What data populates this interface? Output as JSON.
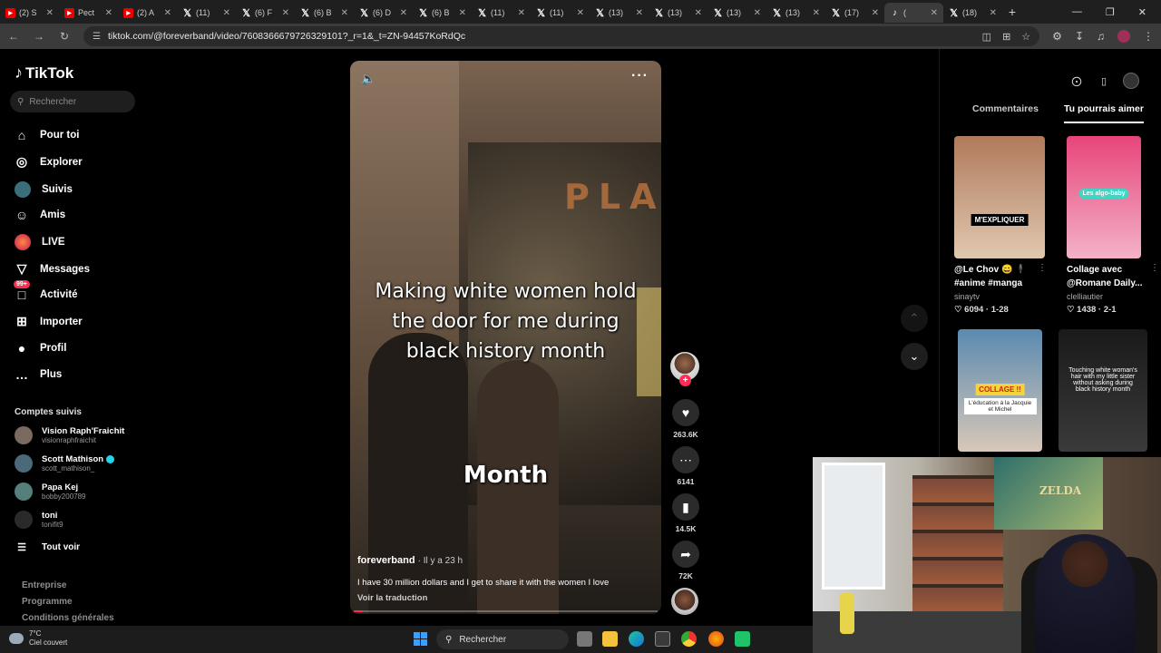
{
  "browser": {
    "tabs": [
      {
        "label": "(2) S",
        "fav": "youtube"
      },
      {
        "label": "Pect",
        "fav": "youtube"
      },
      {
        "label": "(2) A",
        "fav": "youtube"
      },
      {
        "label": "(11)",
        "fav": "x"
      },
      {
        "label": "(6) F",
        "fav": "x"
      },
      {
        "label": "(6) B",
        "fav": "x"
      },
      {
        "label": "(6) D",
        "fav": "x"
      },
      {
        "label": "(6) B",
        "fav": "x"
      },
      {
        "label": "(11)",
        "fav": "x"
      },
      {
        "label": "(11)",
        "fav": "x"
      },
      {
        "label": "(13)",
        "fav": "x"
      },
      {
        "label": "(13)",
        "fav": "x"
      },
      {
        "label": "(13)",
        "fav": "x"
      },
      {
        "label": "(13)",
        "fav": "x"
      },
      {
        "label": "(17)",
        "fav": "x"
      },
      {
        "label": "(",
        "fav": "tiktok",
        "active": true
      },
      {
        "label": "(18)",
        "fav": "x"
      }
    ],
    "url": "tiktok.com/@foreverband/video/7608366679726329101?_r=1&_t=ZN-94457KoRdQc"
  },
  "sidebar": {
    "logo": "TikTok",
    "search_placeholder": "Rechercher",
    "nav": [
      {
        "label": "Pour toi",
        "icon": "home-icon"
      },
      {
        "label": "Explorer",
        "icon": "compass-icon"
      },
      {
        "label": "Suivis",
        "icon": "following-avatar-icon"
      },
      {
        "label": "Amis",
        "icon": "friends-icon"
      },
      {
        "label": "LIVE",
        "icon": "live-icon"
      },
      {
        "label": "Messages",
        "icon": "messages-icon"
      },
      {
        "label": "Activité",
        "icon": "activity-icon",
        "badge": "99+"
      },
      {
        "label": "Importer",
        "icon": "upload-icon"
      },
      {
        "label": "Profil",
        "icon": "profile-icon"
      },
      {
        "label": "Plus",
        "icon": "more-icon"
      }
    ],
    "following_title": "Comptes suivis",
    "following": [
      {
        "name": "Vision Raph'Fraichit",
        "user": "visionraphfraichit",
        "verified": false
      },
      {
        "name": "Scott Mathison",
        "user": "scott_mathison_",
        "verified": true
      },
      {
        "name": "Papa Kej",
        "user": "bobby200789",
        "verified": false
      },
      {
        "name": "toni",
        "user": "tonifit9",
        "verified": false
      }
    ],
    "see_all": "Tout voir",
    "footer": [
      "Entreprise",
      "Programme",
      "Conditions générales"
    ]
  },
  "video": {
    "caption": "Making white women hold the door for me during black history month",
    "overlay_word": "Month",
    "sign_text": "PLA",
    "author": "foreverband",
    "time": "· Il y a 23 h",
    "description": "I have 30 million dollars and I get to share it with the women I love",
    "translate": "Voir la traduction",
    "progress": 0.03,
    "actions": {
      "likes": "263.6K",
      "comments": "6141",
      "saves": "14.5K",
      "shares": "72K"
    }
  },
  "right_panel": {
    "tabs": [
      "Commentaires",
      "Tu pourrais aimer"
    ],
    "active_tab": "Tu pourrais aimer",
    "items": [
      {
        "title": "@Le Chov 😄 🕴 #anime #manga",
        "user": "sinaytv",
        "likes": "6094",
        "date": "1-28",
        "overlay": "M'EXPLIQUER",
        "colors": [
          "#b07a5a",
          "#e0c8b0"
        ]
      },
      {
        "title": "Collage avec @Romane Daily...",
        "user": "clelliautier",
        "likes": "1438",
        "date": "2-1",
        "overlay": "Les algo-baby",
        "colors": [
          "#e8457a",
          "#f3b2c8"
        ]
      },
      {
        "title": "",
        "user": "",
        "likes": "",
        "date": "",
        "overlay": "COLLAGE !!",
        "sub": "L'éducation à la Jacquie et Michel",
        "colors": [
          "#5a8ab0",
          "#d8c8b8"
        ]
      },
      {
        "title": "",
        "user": "",
        "likes": "",
        "date": "",
        "overlay": "Touching white woman's hair with my little sister without asking during black history month",
        "colors": [
          "#1a1a1a",
          "#3a3a3a"
        ]
      }
    ]
  },
  "webcam": {
    "poster_text": "ZELDA"
  },
  "taskbar": {
    "weather_temp": "7°C",
    "weather_desc": "Ciel couvert",
    "search_placeholder": "Rechercher"
  },
  "colors": {
    "accent": "#fe2c55",
    "verified": "#20d5ec"
  }
}
